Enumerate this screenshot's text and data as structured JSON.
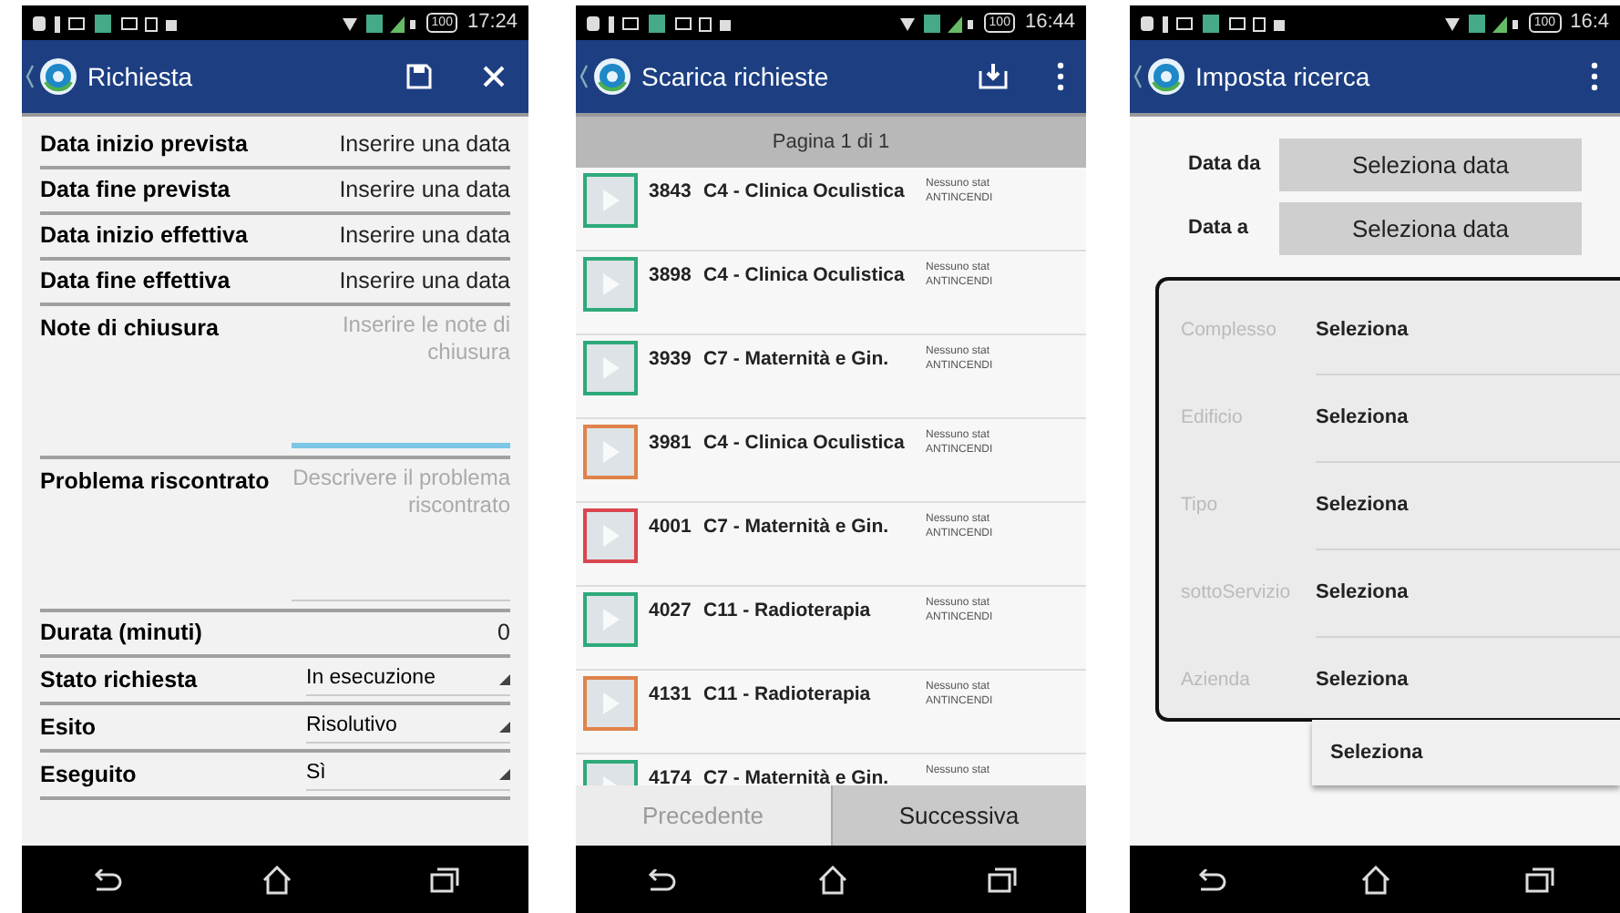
{
  "screens": [
    {
      "kind": "form",
      "status_bar": {
        "time": "17:24",
        "battery": "100"
      },
      "app_bar": {
        "title": "Richiesta",
        "actions": [
          {
            "kind": "save"
          },
          {
            "kind": "close"
          }
        ]
      },
      "fields": [
        {
          "kind": "date",
          "label": "Data inizio prevista",
          "value": "Inserire una data"
        },
        {
          "kind": "date",
          "label": "Data fine prevista",
          "value": "Inserire una data"
        },
        {
          "kind": "date",
          "label": "Data inizio effettiva",
          "value": "Inserire una data"
        },
        {
          "kind": "date",
          "label": "Data fine effettiva",
          "value": "Inserire una data"
        },
        {
          "kind": "note",
          "label": "Note di chiusura",
          "placeholder": "Inserire le note di chiusura",
          "focused": true
        },
        {
          "kind": "note",
          "label": "Problema riscontrato",
          "placeholder": "Descrivere il problema riscontrato",
          "focused": false
        },
        {
          "kind": "number",
          "label": "Durata (minuti)",
          "value": "0"
        },
        {
          "kind": "dropdown",
          "label": "Stato richiesta",
          "value": "In esecuzione"
        },
        {
          "kind": "dropdown",
          "label": "Esito",
          "value": "Risolutivo"
        },
        {
          "kind": "dropdown",
          "label": "Eseguito",
          "value": "Sì"
        }
      ]
    },
    {
      "kind": "list",
      "status_bar": {
        "time": "16:44",
        "battery": "100"
      },
      "app_bar": {
        "title": "Scarica richieste",
        "actions": [
          {
            "kind": "download"
          },
          {
            "kind": "more"
          }
        ]
      },
      "page_label": "Pagina 1 di 1",
      "rows": [
        {
          "number": "3843",
          "title": "C4 - Clinica Oculistica",
          "status": "Nessuno stat",
          "category": "ANTINCENDI",
          "color": "#2eaa7a"
        },
        {
          "number": "3898",
          "title": "C4 - Clinica Oculistica",
          "status": "Nessuno stat",
          "category": "ANTINCENDI",
          "color": "#2eaa7a"
        },
        {
          "number": "3939",
          "title": "C7 - Maternità e Gin.",
          "status": "Nessuno stat",
          "category": "ANTINCENDI",
          "color": "#2eaa7a"
        },
        {
          "number": "3981",
          "title": "C4 - Clinica Oculistica",
          "status": "Nessuno stat",
          "category": "ANTINCENDI",
          "color": "#e0824a"
        },
        {
          "number": "4001",
          "title": "C7 - Maternità e Gin.",
          "status": "Nessuno stat",
          "category": "ANTINCENDI",
          "color": "#d9464f"
        },
        {
          "number": "4027",
          "title": "C11 - Radioterapia",
          "status": "Nessuno stat",
          "category": "ANTINCENDI",
          "color": "#2eaa7a"
        },
        {
          "number": "4131",
          "title": "C11 - Radioterapia",
          "status": "Nessuno stat",
          "category": "ANTINCENDI",
          "color": "#e0824a"
        },
        {
          "number": "4174",
          "title": "C7 - Maternità e Gin.",
          "status": "Nessuno stat",
          "color": "#2eaa7a"
        }
      ],
      "buttons": [
        {
          "label": "Precedente",
          "disabled": true
        },
        {
          "label": "Successiva",
          "disabled": false
        }
      ]
    },
    {
      "kind": "search",
      "status_bar": {
        "time": "16:4",
        "battery": "100"
      },
      "app_bar": {
        "title": "Imposta ricerca",
        "actions": [
          {
            "kind": "more"
          }
        ]
      },
      "date_fields": [
        {
          "label": "Data da",
          "button": "Seleziona data"
        },
        {
          "label": "Data a",
          "button": "Seleziona data"
        }
      ],
      "filters": [
        {
          "label": "Complesso",
          "value": "Seleziona"
        },
        {
          "label": "Edificio",
          "value": "Seleziona"
        },
        {
          "label": "Tipo",
          "value": "Seleziona"
        },
        {
          "label": "sottoServizio",
          "value": "Seleziona"
        },
        {
          "label": "Azienda",
          "value": "Seleziona"
        }
      ],
      "dropdown_options": [
        "Seleziona"
      ]
    }
  ]
}
